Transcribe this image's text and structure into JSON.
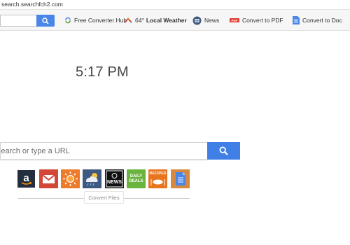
{
  "browser": {
    "url": "search.searchfch2.com"
  },
  "toolbar": {
    "items": [
      {
        "label": "Free Converter Hub",
        "icon": "refresh-arrows-icon"
      },
      {
        "degrees": "64°",
        "label": "Local Weather",
        "icon": "weather-icon"
      },
      {
        "label": "News",
        "icon": "news-icon"
      },
      {
        "label": "Convert to PDF",
        "icon": "pdf-icon"
      },
      {
        "label": "Convert to Doc",
        "icon": "doc-icon"
      }
    ]
  },
  "clock": {
    "time": "5:17 PM"
  },
  "search": {
    "placeholder": "Search or type a URL"
  },
  "tiles": [
    {
      "name": "amazon",
      "icon": "amazon-icon",
      "color": "#232f3e"
    },
    {
      "name": "gmail",
      "icon": "gmail-icon",
      "color": "#d44638"
    },
    {
      "name": "weather",
      "icon": "sun-icon",
      "color": "#ee7b2b"
    },
    {
      "name": "weather-forecast",
      "icon": "cloud-weather-icon",
      "color": "#3e5a80"
    },
    {
      "name": "news",
      "icon": "news-tile-icon",
      "label": "NEWS",
      "color": "#111111"
    },
    {
      "name": "daily-deals",
      "icon": "deals-icon",
      "label_line1": "DAILY",
      "label_line2": "DEALS",
      "color": "#6ab43e"
    },
    {
      "name": "recipes",
      "icon": "recipes-icon",
      "label": "RECIPES",
      "color": "#e8741e"
    },
    {
      "name": "docs",
      "icon": "document-icon",
      "color": "#d9893e"
    }
  ],
  "footer": {
    "convert_label": "Convert Files"
  },
  "colors": {
    "search_button": "#3f7fe6",
    "toolbar_bg": "#f6f6f6"
  }
}
